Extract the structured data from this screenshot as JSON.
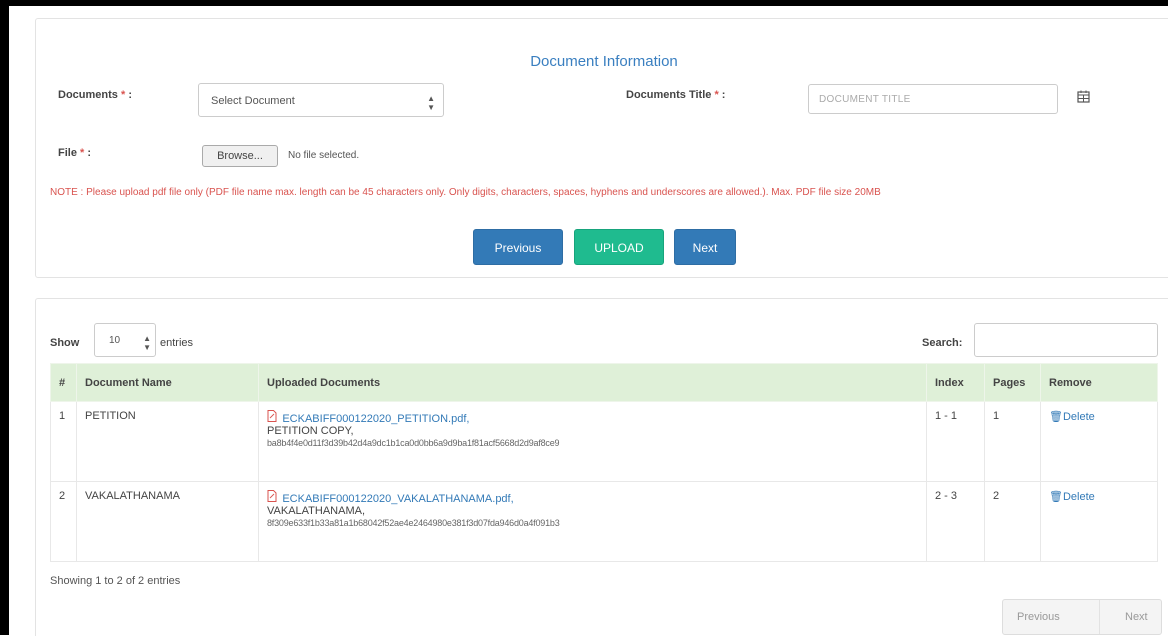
{
  "form": {
    "section_title": "Document Information",
    "documents_label": "Documents",
    "documents_select_value": "Select Document",
    "title_label": "Documents Title",
    "title_placeholder": "DOCUMENT TITLE",
    "file_label": "File",
    "required_marker": "*",
    "colon": ":",
    "browse_label": "Browse...",
    "file_status": "No file selected.",
    "note": "NOTE : Please upload pdf file only (PDF file name max. length can be 45 characters only. Only digits, characters, spaces, hyphens and underscores are allowed.). Max. PDF file size 20MB",
    "btn_previous": "Previous",
    "btn_upload": "UPLOAD",
    "btn_next": "Next"
  },
  "table_controls": {
    "show_label": "Show",
    "length_value": "10",
    "entries_label": "entries",
    "search_label": "Search:"
  },
  "table": {
    "headers": [
      "#",
      "Document Name",
      "Uploaded Documents",
      "Index",
      "Pages",
      "Remove"
    ],
    "rows": [
      {
        "num": "1",
        "name": "PETITION",
        "file_name": "ECKABIFF000122020_PETITION.pdf,",
        "copy_label": "PETITION COPY,",
        "hash": "ba8b4f4e0d11f3d39b42d4a9dc1b1ca0d0bb6a9d9ba1f81acf5668d2d9af8ce9",
        "index": "1 - 1",
        "pages": "1",
        "remove": "Delete"
      },
      {
        "num": "2",
        "name": "VAKALATHANAMA",
        "file_name": "ECKABIFF000122020_VAKALATHANAMA.pdf,",
        "copy_label": "VAKALATHANAMA,",
        "hash": "8f309e633f1b33a81a1b68042f52ae4e2464980e381f3d07fda946d0a4f091b3",
        "index": "2 - 3",
        "pages": "2",
        "remove": "Delete"
      }
    ]
  },
  "info": "Showing 1 to 2 of 2 entries",
  "pagination": {
    "previous": "Previous",
    "next": "Next"
  },
  "icons": {
    "pdf": "file-pdf-icon",
    "trash": "trash-icon",
    "calendar": "calendar-icon"
  },
  "colors": {
    "primary": "#337ab7",
    "upload": "#1fbb8f",
    "danger": "#d9534f",
    "table_header": "#dff0d8"
  }
}
